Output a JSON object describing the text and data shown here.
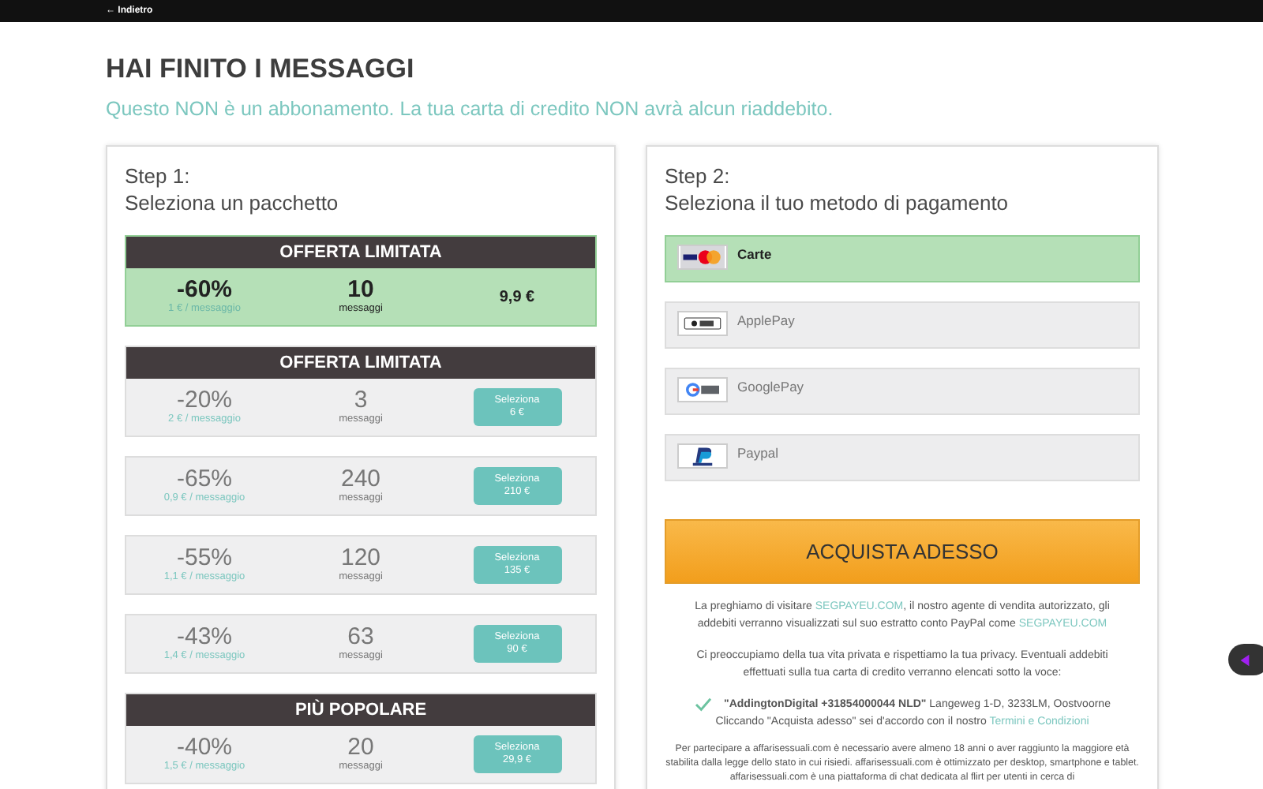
{
  "topbar": {
    "back_link": "← Indietro"
  },
  "heading": "HAI FINITO I MESSAGGI",
  "subtitle": "Questo NON è un abbonamento. La tua carta di credito NON avrà alcun riaddebito.",
  "step1": {
    "title": "Step 1:",
    "subtitle": "Seleziona un pacchetto",
    "packages": [
      {
        "header": "OFFERTA LIMITATA",
        "discount": "-60%",
        "per_message": "1 € / messaggio",
        "count": "10",
        "unit": "messaggi",
        "price": "9,9 €",
        "selected": true
      },
      {
        "header": "OFFERTA LIMITATA",
        "discount": "-20%",
        "per_message": "2 € / messaggio",
        "count": "3",
        "unit": "messaggi",
        "button_label": "Seleziona",
        "price": "6 €",
        "selected": false
      },
      {
        "discount": "-65%",
        "per_message": "0,9 € / messaggio",
        "count": "240",
        "unit": "messaggi",
        "button_label": "Seleziona",
        "price": "210 €",
        "selected": false
      },
      {
        "discount": "-55%",
        "per_message": "1,1 € / messaggio",
        "count": "120",
        "unit": "messaggi",
        "button_label": "Seleziona",
        "price": "135 €",
        "selected": false
      },
      {
        "discount": "-43%",
        "per_message": "1,4 € / messaggio",
        "count": "63",
        "unit": "messaggi",
        "button_label": "Seleziona",
        "price": "90 €",
        "selected": false
      },
      {
        "header": "PIÙ POPOLARE",
        "discount": "-40%",
        "per_message": "1,5 € / messaggio",
        "count": "20",
        "unit": "messaggi",
        "button_label": "Seleziona",
        "price": "29,9 €",
        "selected": false
      }
    ]
  },
  "step2": {
    "title": "Step 2:",
    "subtitle": "Seleziona il tuo metodo di pagamento",
    "methods": [
      {
        "kind": "cards",
        "label": "Carte",
        "selected": true
      },
      {
        "kind": "applepay",
        "label": "ApplePay",
        "selected": false
      },
      {
        "kind": "googlepay",
        "label": "GooglePay",
        "selected": false
      },
      {
        "kind": "paypal",
        "label": "Paypal",
        "selected": false
      }
    ],
    "buy_button": "ACQUISTA ADESSO",
    "notes": [
      {
        "kind": "plain",
        "parts": [
          {
            "text": "La preghiamo di visitare "
          },
          {
            "link": "SEGPAYEU.COM"
          },
          {
            "text": ", il nostro agente di vendita autorizzato, gli addebiti verranno visualizzati sul suo estratto conto PayPal come "
          },
          {
            "link": "SEGPAYEU.COM"
          }
        ]
      },
      {
        "kind": "plain",
        "parts": [
          {
            "text": "Ci preoccupiamo della tua vita privata e rispettiamo la tua privacy. Eventuali addebiti effettuati sulla tua carta di credito verranno elencati sotto la voce:"
          }
        ]
      },
      {
        "kind": "checked",
        "parts": [
          {
            "text": "**\"AddingtonDigital +31854000044 NLD\"** Langeweg 1-D, 3233LM, Oostvoorne"
          }
        ]
      },
      {
        "kind": "plain",
        "parts": [
          {
            "text": "Cliccando \"Acquista adesso\" sei d'accordo con il nostro "
          },
          {
            "link": "Termini e Condizioni"
          }
        ]
      },
      {
        "kind": "small",
        "parts": [
          {
            "text": "Per partecipare a affarisessuali.com è necessario avere almeno 18 anni o aver raggiunto la maggiore età stabilita dalla legge dello stato in cui risiedi. affarisessuali.com è ottimizzato per desktop, smartphone e tablet. affarisessuali.com è una piattaforma di chat dedicata al flirt per utenti in cerca di"
          }
        ]
      }
    ]
  }
}
